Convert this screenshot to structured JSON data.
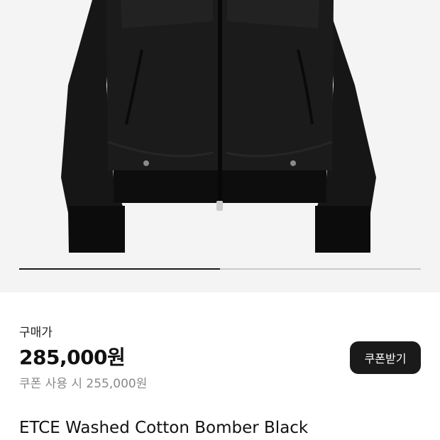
{
  "image": {
    "icon": "product-photo-black-bomber-jacket",
    "alt": "ETCE Washed Cotton Bomber Black",
    "carousel_progress": 0.5
  },
  "price": {
    "label": "구매가",
    "amount": "285,000원",
    "coupon_text": "쿠폰 사용 시 255,000원"
  },
  "coupon_button": {
    "label": "쿠폰받기"
  },
  "product": {
    "title": "ETCE Washed Cotton Bomber Black"
  },
  "colors": {
    "accent": "#1a1a1a",
    "muted": "#8a8a8a",
    "image_bg": "#f4f4f4"
  }
}
